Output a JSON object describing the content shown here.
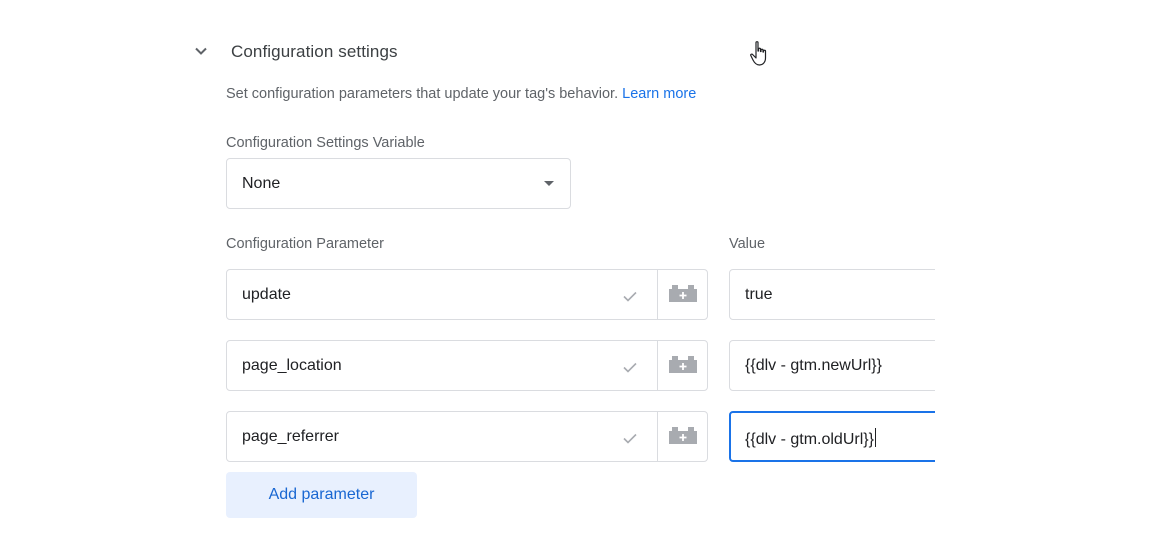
{
  "section": {
    "title": "Configuration settings",
    "description": "Set configuration parameters that update your tag's behavior.",
    "learn_more": "Learn more"
  },
  "settings_variable": {
    "label": "Configuration Settings Variable",
    "selected": "None"
  },
  "parameters": {
    "param_header": "Configuration Parameter",
    "value_header": "Value",
    "rows": [
      {
        "name": "update",
        "value": "true"
      },
      {
        "name": "page_location",
        "value": "{{dlv - gtm.newUrl}}"
      },
      {
        "name": "page_referrer",
        "value": "{{dlv - gtm.oldUrl}}"
      }
    ],
    "add_label": "Add parameter"
  },
  "icons": {
    "chevron": "chevron-down-icon",
    "check": "check-icon",
    "variable": "variable-block-icon",
    "cursor": "hand-pointer-icon"
  },
  "colors": {
    "accent": "#1a73e8",
    "button_bg": "#e8f0fe",
    "border": "#dadce0",
    "muted_text": "#5f6368"
  }
}
